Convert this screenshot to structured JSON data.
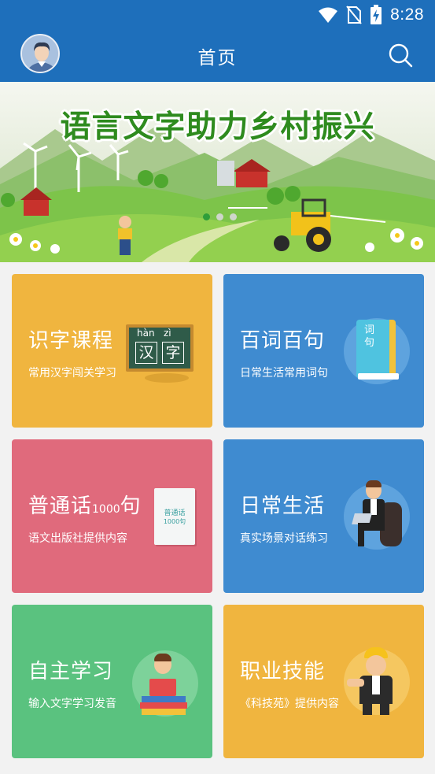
{
  "status_bar": {
    "time": "8:28",
    "icons": [
      "wifi-icon",
      "no-sim-icon",
      "battery-charging-icon"
    ]
  },
  "app_bar": {
    "title": "首页",
    "left_icon": "avatar",
    "right_icon": "search-icon"
  },
  "banner": {
    "title": "语言文字助力乡村振兴",
    "slide_indicators": 3,
    "active_slide": 1
  },
  "cards": [
    {
      "title": "识字课程",
      "subtitle": "常用汉字闯关学习",
      "color": "#f0b53f",
      "icon": "blackboard-icon",
      "board_pinyin": "hàn   zì",
      "board_chars": [
        "汉",
        "字"
      ]
    },
    {
      "title": "百词百句",
      "subtitle": "日常生活常用词句",
      "color": "#3f8bd0",
      "icon": "book-icon",
      "book_label": "词句"
    },
    {
      "title_main": "普通话",
      "title_small": "1000",
      "title_end": "句",
      "subtitle": "语文出版社提供内容",
      "color": "#e06a7c",
      "icon": "book-cover-icon",
      "cover_title": "普通话",
      "cover_sub": "1000句"
    },
    {
      "title": "日常生活",
      "subtitle": "真实场景对话练习",
      "color": "#3f8bd0",
      "icon": "man-with-laptop-icon"
    },
    {
      "title": "自主学习",
      "subtitle": "输入文字学习发音",
      "color": "#5ac27f",
      "icon": "student-reading-icon"
    },
    {
      "title": "职业技能",
      "subtitle": "《科技苑》提供内容",
      "color": "#f0b53f",
      "icon": "worker-helmet-icon"
    }
  ]
}
